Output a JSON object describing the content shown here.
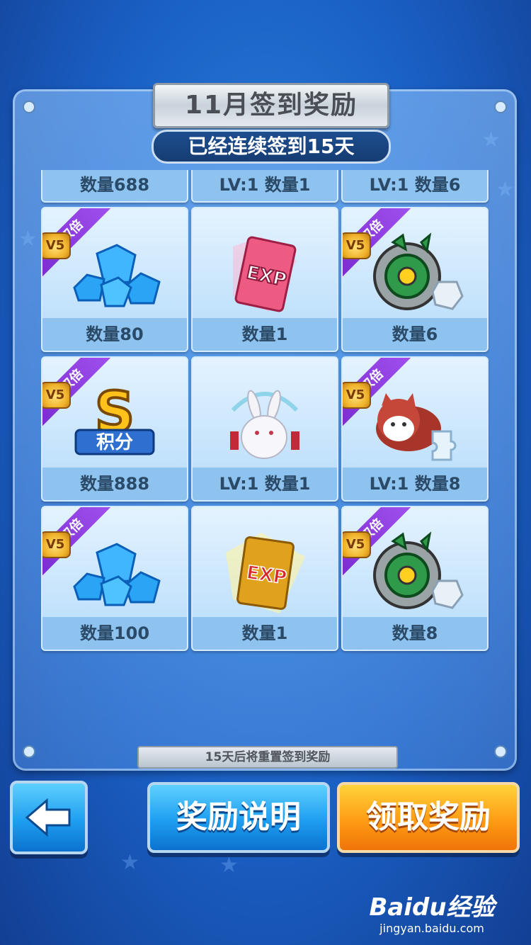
{
  "title": "11月签到奖励",
  "streak": "已经连续签到15天",
  "double_label": "双倍",
  "vip_label": "V5",
  "rewards": [
    {
      "label": "数量688",
      "icon": "points-s-icon",
      "double": true
    },
    {
      "label": "LV:1 数量1",
      "icon": "exp-card-red-icon",
      "double": false
    },
    {
      "label": "LV:1 数量6",
      "icon": "cat-puzzle-icon",
      "double": true
    },
    {
      "label": "数量80",
      "icon": "diamond-icon",
      "double": true
    },
    {
      "label": "数量1",
      "icon": "exp-card-red-icon",
      "double": false
    },
    {
      "label": "数量6",
      "icon": "mech-claw-icon",
      "double": true
    },
    {
      "label": "数量888",
      "icon": "points-s-icon",
      "double": true
    },
    {
      "label": "LV:1 数量1",
      "icon": "rabbit-pet-icon",
      "double": false
    },
    {
      "label": "LV:1 数量8",
      "icon": "cat-puzzle-icon",
      "double": true
    },
    {
      "label": "数量100",
      "icon": "diamond-icon",
      "double": true
    },
    {
      "label": "数量1",
      "icon": "exp-card-gold-icon",
      "double": false
    },
    {
      "label": "数量8",
      "icon": "mech-claw-icon",
      "double": true
    }
  ],
  "footer_note": "15天后将重置签到奖励",
  "buttons": {
    "help": "奖励说明",
    "claim": "领取奖励"
  },
  "watermark": {
    "brand": "Baidu经验",
    "url": "jingyan.baidu.com"
  }
}
